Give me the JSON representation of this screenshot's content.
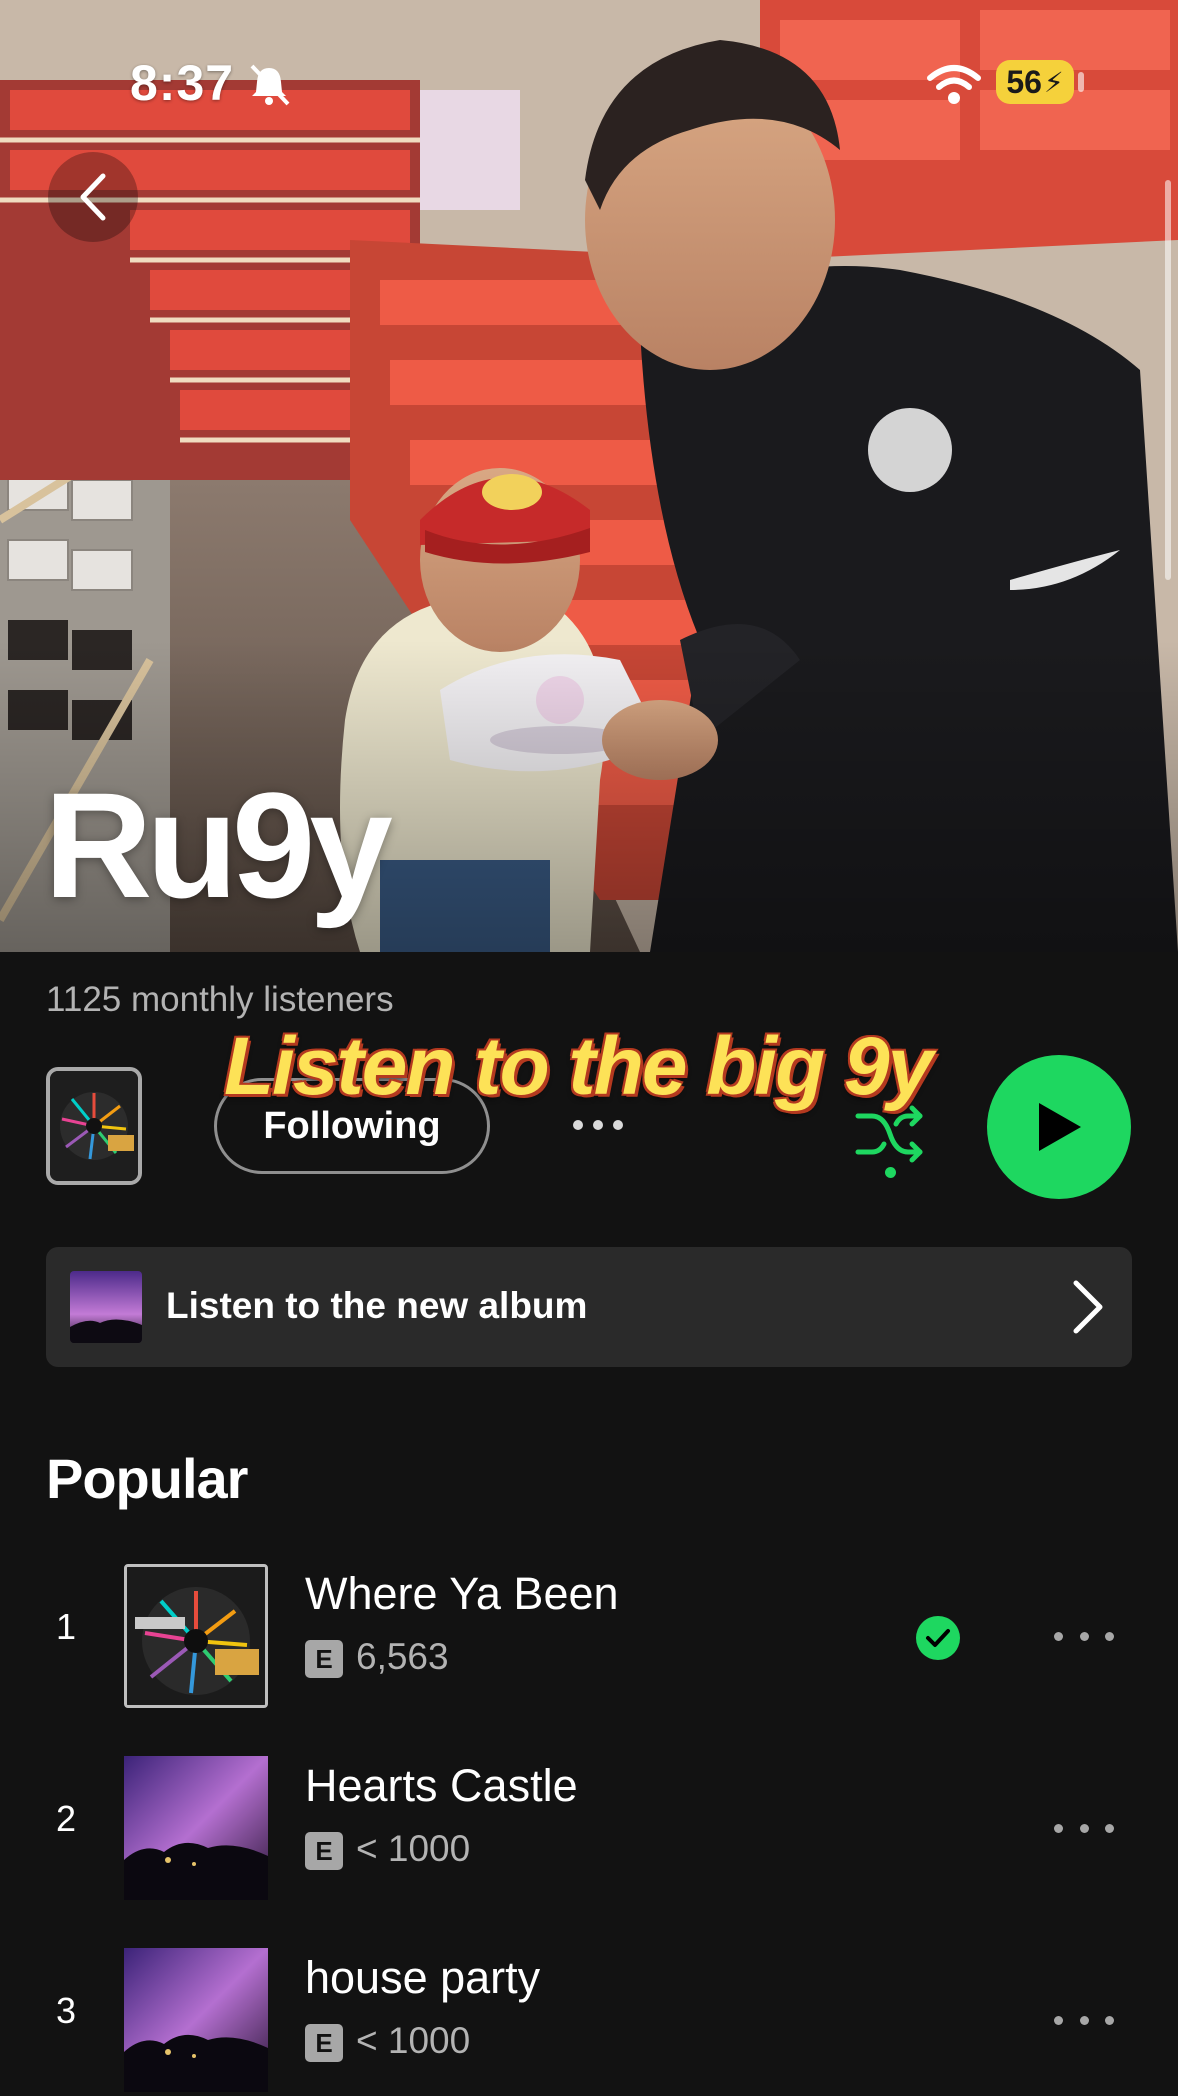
{
  "status_bar": {
    "time": "8:37",
    "battery": "56"
  },
  "artist": {
    "name": "Ru9y",
    "monthly_listeners": "1125 monthly listeners"
  },
  "overlay_caption": "Listen to the big 9y",
  "actions": {
    "follow_label": "Following"
  },
  "promo": {
    "label": "Listen to the new album"
  },
  "popular": {
    "title": "Popular",
    "tracks": [
      {
        "rank": "1",
        "title": "Where Ya Been",
        "explicit": "E",
        "plays": "6,563",
        "saved": true
      },
      {
        "rank": "2",
        "title": "Hearts Castle",
        "explicit": "E",
        "plays": "< 1000",
        "saved": false
      },
      {
        "rank": "3",
        "title": "house party",
        "explicit": "E",
        "plays": "< 1000",
        "saved": false
      }
    ]
  },
  "colors": {
    "accent": "#1ed760",
    "background": "#121212",
    "caption_fill": "#fde257",
    "caption_outline": "#b4391f"
  },
  "icons": [
    "back-chevron-icon",
    "bell-slash-icon",
    "wifi-icon",
    "shuffle-icon",
    "play-icon",
    "chevron-right-icon",
    "check-icon",
    "more-dots-icon"
  ]
}
